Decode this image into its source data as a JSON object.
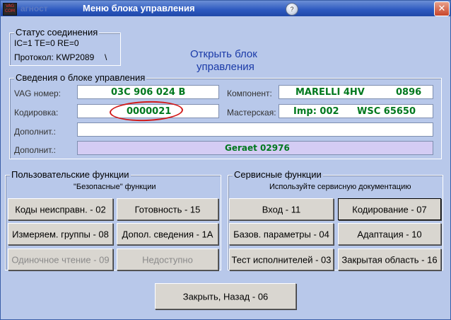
{
  "window": {
    "ghost_title": "агност",
    "title": "Меню блока управления",
    "app_icon_text": "VAG COM",
    "close_glyph": "✕",
    "help_glyph": "?"
  },
  "status": {
    "legend": "Статус соединения",
    "line1": "IC=1  TE=0  RE=0",
    "protocol": "Протокол: KWP2089",
    "indicator": "\\"
  },
  "open_block": {
    "line1": "Открыть блок",
    "line2": "управления"
  },
  "info": {
    "legend": "Сведения о блоке управления",
    "vag_label": "VAG номер:",
    "vag_value": "03C 906 024 B",
    "coding_label": "Кодировка:",
    "coding_value": "0000021",
    "extra_label": "Дополнит.:",
    "extra_value": "",
    "extra2_label": "Дополнит.:",
    "extra2_value": "Geraet 02976",
    "component_label": "Компонент:",
    "component_value": "MARELLI 4HV",
    "component_code": "0896",
    "workshop_label": "Мастерская:",
    "workshop_imp": "Imp: 002",
    "workshop_wsc": "WSC 65650"
  },
  "user_functions": {
    "legend": "Пользовательские функции",
    "subtitle": "\"Безопасные\" функции",
    "buttons": [
      "Коды неисправн. - 02",
      "Готовность - 15",
      "Измеряем. группы - 08",
      "Допол. сведения - 1А",
      "Одиночное чтение - 09",
      "Недоступно"
    ]
  },
  "service_functions": {
    "legend": "Сервисные функции",
    "subtitle": "Используйте сервисную документацию",
    "buttons": [
      "Вход - 11",
      "Кодирование - 07",
      "Базов. параметры - 04",
      "Адаптация - 10",
      "Тест исполнителей - 03",
      "Закрытая область - 16"
    ]
  },
  "close_button": "Закрыть, Назад - 06",
  "colors": {
    "value_text": "#00781e",
    "highlight_ring": "#d11a1a",
    "geraet_bg": "#d4ccf4"
  }
}
